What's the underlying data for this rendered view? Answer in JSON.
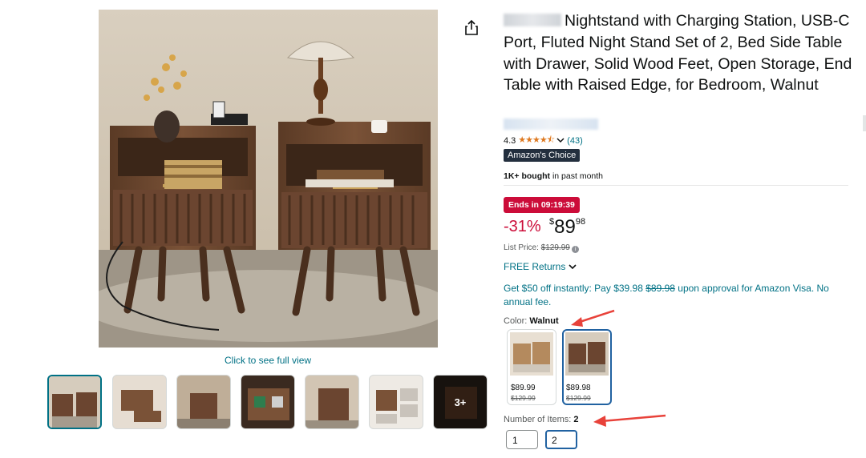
{
  "product": {
    "title": "Nightstand with Charging Station, USB-C Port, Fluted Night Stand Set of 2, Bed Side Table with Drawer, Solid Wood Feet, Open Storage, End Table with Raised Edge, for Bedroom, Walnut",
    "rating": "4.3",
    "stars": "★★★★⯪",
    "rating_count": "(43)",
    "badge": "Amazon's Choice",
    "bought_bold": "1K+ bought",
    "bought_rest": " in past month"
  },
  "deal": {
    "ends": "Ends in 09:19:39"
  },
  "price": {
    "discount": "-31%",
    "currency": "$",
    "whole": "89",
    "fraction": "98",
    "list_label": "List Price: ",
    "list_value": "$129.99"
  },
  "returns": {
    "label": "FREE Returns"
  },
  "offer": {
    "lead": "Get $50 off instantly: Pay $39.98 ",
    "strike": "$89.98",
    "tail": " upon approval for Amazon Visa. No annual fee."
  },
  "color": {
    "label": "Color: ",
    "value": "Walnut",
    "options": [
      {
        "price": "$89.99",
        "list": "$129.99"
      },
      {
        "price": "$89.98",
        "list": "$129.99"
      }
    ]
  },
  "items": {
    "label": "Number of Items: ",
    "value": "2",
    "options": [
      "1",
      "2"
    ]
  },
  "gallery": {
    "see_full": "Click to see full view",
    "more": "3+"
  },
  "colors": {
    "link": "#007185",
    "deal": "#cc0c39",
    "selected": "#2162a1",
    "stars": "#de7921",
    "arrow": "#e8423a"
  },
  "icons": [
    "share-icon",
    "info-icon",
    "chevron-down-icon",
    "arrow-annotation"
  ]
}
